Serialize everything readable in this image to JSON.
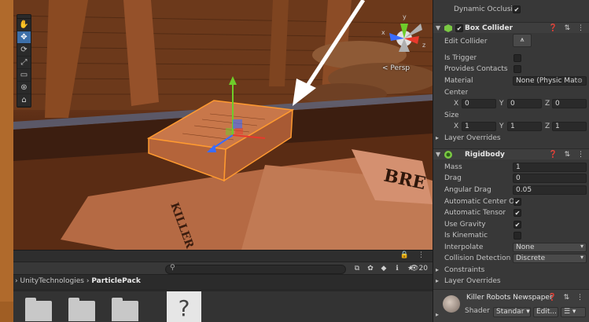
{
  "scene": {
    "projection_label": "< Persp",
    "axis_gizmo": {
      "x": "x",
      "y": "y",
      "z": "z"
    },
    "tools": [
      {
        "name": "hand-tool-icon",
        "glyph": "✋"
      },
      {
        "name": "move-tool-icon",
        "glyph": "✥"
      },
      {
        "name": "rotate-tool-icon",
        "glyph": "⟳"
      },
      {
        "name": "scale-tool-icon",
        "glyph": "⤢"
      },
      {
        "name": "rect-tool-icon",
        "glyph": "▭"
      },
      {
        "name": "transform-tool-icon",
        "glyph": "⊛"
      },
      {
        "name": "custom-tool-icon",
        "glyph": "⌂"
      }
    ],
    "newspaper_text": {
      "headline_small": "BRE",
      "side_text": "KILLER RO"
    }
  },
  "project": {
    "header_icons": "🔒 ⋮",
    "search": {
      "placeholder": "",
      "icon": "search-icon"
    },
    "toolbar_icons": [
      "⧉",
      "✿",
      "◆",
      "ℹ",
      "★"
    ],
    "count": "20",
    "breadcrumb": {
      "sep1": "›",
      "path1": "UnityTechnologies",
      "sep2": "›",
      "path2": "ParticlePack"
    },
    "unknown_file_glyph": "?"
  },
  "inspector": {
    "dynamic_occlusion": {
      "label": "Dynamic Occlusic",
      "checked": "✔"
    },
    "box_collider": {
      "title": "Box Collider",
      "enabled": "✔",
      "edit_collider": "Edit Collider",
      "edit_icon": "⩚",
      "is_trigger": "Is Trigger",
      "provides_contacts": "Provides Contacts",
      "material_label": "Material",
      "material_value": "None (Physic Mat",
      "center_label": "Center",
      "center": {
        "x": "0",
        "y": "0",
        "z": "0"
      },
      "size_label": "Size",
      "size": {
        "x": "1",
        "y": "1",
        "z": "1"
      },
      "layer_overrides": "Layer Overrides"
    },
    "rigidbody": {
      "title": "Rigidbody",
      "mass_label": "Mass",
      "mass": "1",
      "drag_label": "Drag",
      "drag": "0",
      "angular_drag_label": "Angular Drag",
      "angular_drag": "0.05",
      "auto_center_label": "Automatic Center Of",
      "auto_center": "✔",
      "auto_tensor_label": "Automatic Tensor",
      "auto_tensor": "✔",
      "use_gravity_label": "Use Gravity",
      "use_gravity": "✔",
      "is_kinematic_label": "Is Kinematic",
      "interpolate_label": "Interpolate",
      "interpolate": "None",
      "collision_label": "Collision Detection",
      "collision": "Discrete",
      "constraints": "Constraints",
      "layer_overrides": "Layer Overrides"
    },
    "material": {
      "name": "Killer Robots Newspaper",
      "shader_label": "Shader",
      "shader_value": "Standar",
      "edit_label": "Edit...",
      "list_icon": "☰ ▾"
    },
    "header_icons": "❓ ⇅ ⋮"
  }
}
